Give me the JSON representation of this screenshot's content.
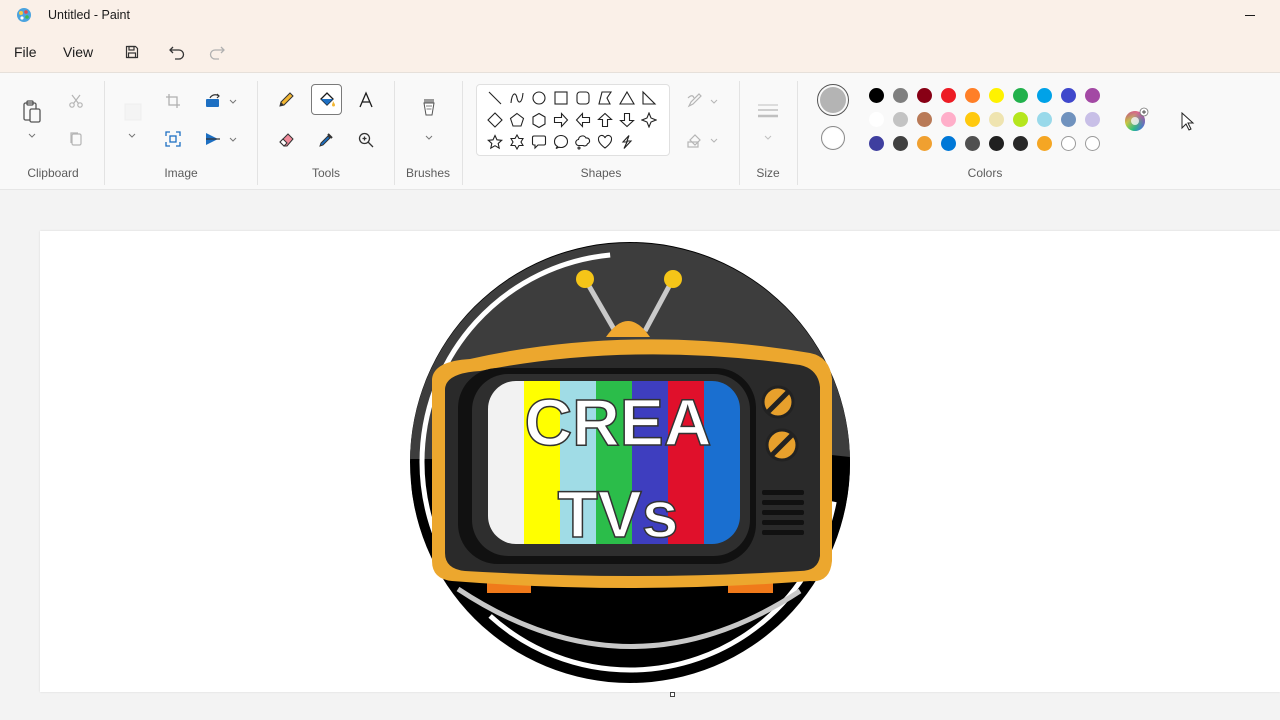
{
  "window": {
    "title": "Untitled - Paint"
  },
  "menu": {
    "file": "File",
    "view": "View"
  },
  "quick_access": [
    "save-icon",
    "undo-icon",
    "redo-icon"
  ],
  "ribbon": {
    "groups": {
      "clipboard": "Clipboard",
      "image": "Image",
      "tools": "Tools",
      "brushes": "Brushes",
      "shapes": "Shapes",
      "size": "Size",
      "colors": "Colors"
    },
    "active_tool": "fill-bucket",
    "shapes": [
      "line",
      "curve",
      "oval",
      "rectangle",
      "rounded-rectangle",
      "polygon",
      "triangle",
      "right-triangle",
      "diamond",
      "pentagon",
      "hexagon",
      "left-arrow",
      "right-arrow",
      "up-arrow",
      "down-arrow",
      "four-point-star",
      "five-point-star",
      "six-point-star",
      "rounded-callout",
      "oval-callout",
      "cloud-callout",
      "heart",
      "lightning"
    ],
    "primary_color": "#b4b4b4",
    "secondary_color": "#ffffff",
    "palette": [
      [
        "#000000",
        "#7f7f7f",
        "#880015",
        "#ed1c24",
        "#ff7f27",
        "#fff200",
        "#22b14c",
        "#00a2e8",
        "#3f48cc",
        "#a349a4"
      ],
      [
        "#ffffff",
        "#c3c3c3",
        "#b97a57",
        "#ffaec9",
        "#ffc90e",
        "#efe4b0",
        "#b5e61d",
        "#99d9ea",
        "#7092be",
        "#c8bfe7"
      ],
      [
        "#3f3f9f",
        "#404040",
        "#f0a030",
        "#0078d7",
        "#505050",
        "#202020",
        "#282828",
        "#f5a623",
        "empty",
        "empty"
      ]
    ]
  },
  "artwork": {
    "line1": "CREA",
    "line2": "TVs",
    "bar_colors": [
      "#f2f2f2",
      "#ffff00",
      "#a0dce6",
      "#2bbd4a",
      "#3e3ebf",
      "#e0102b",
      "#1a6fd0"
    ]
  }
}
